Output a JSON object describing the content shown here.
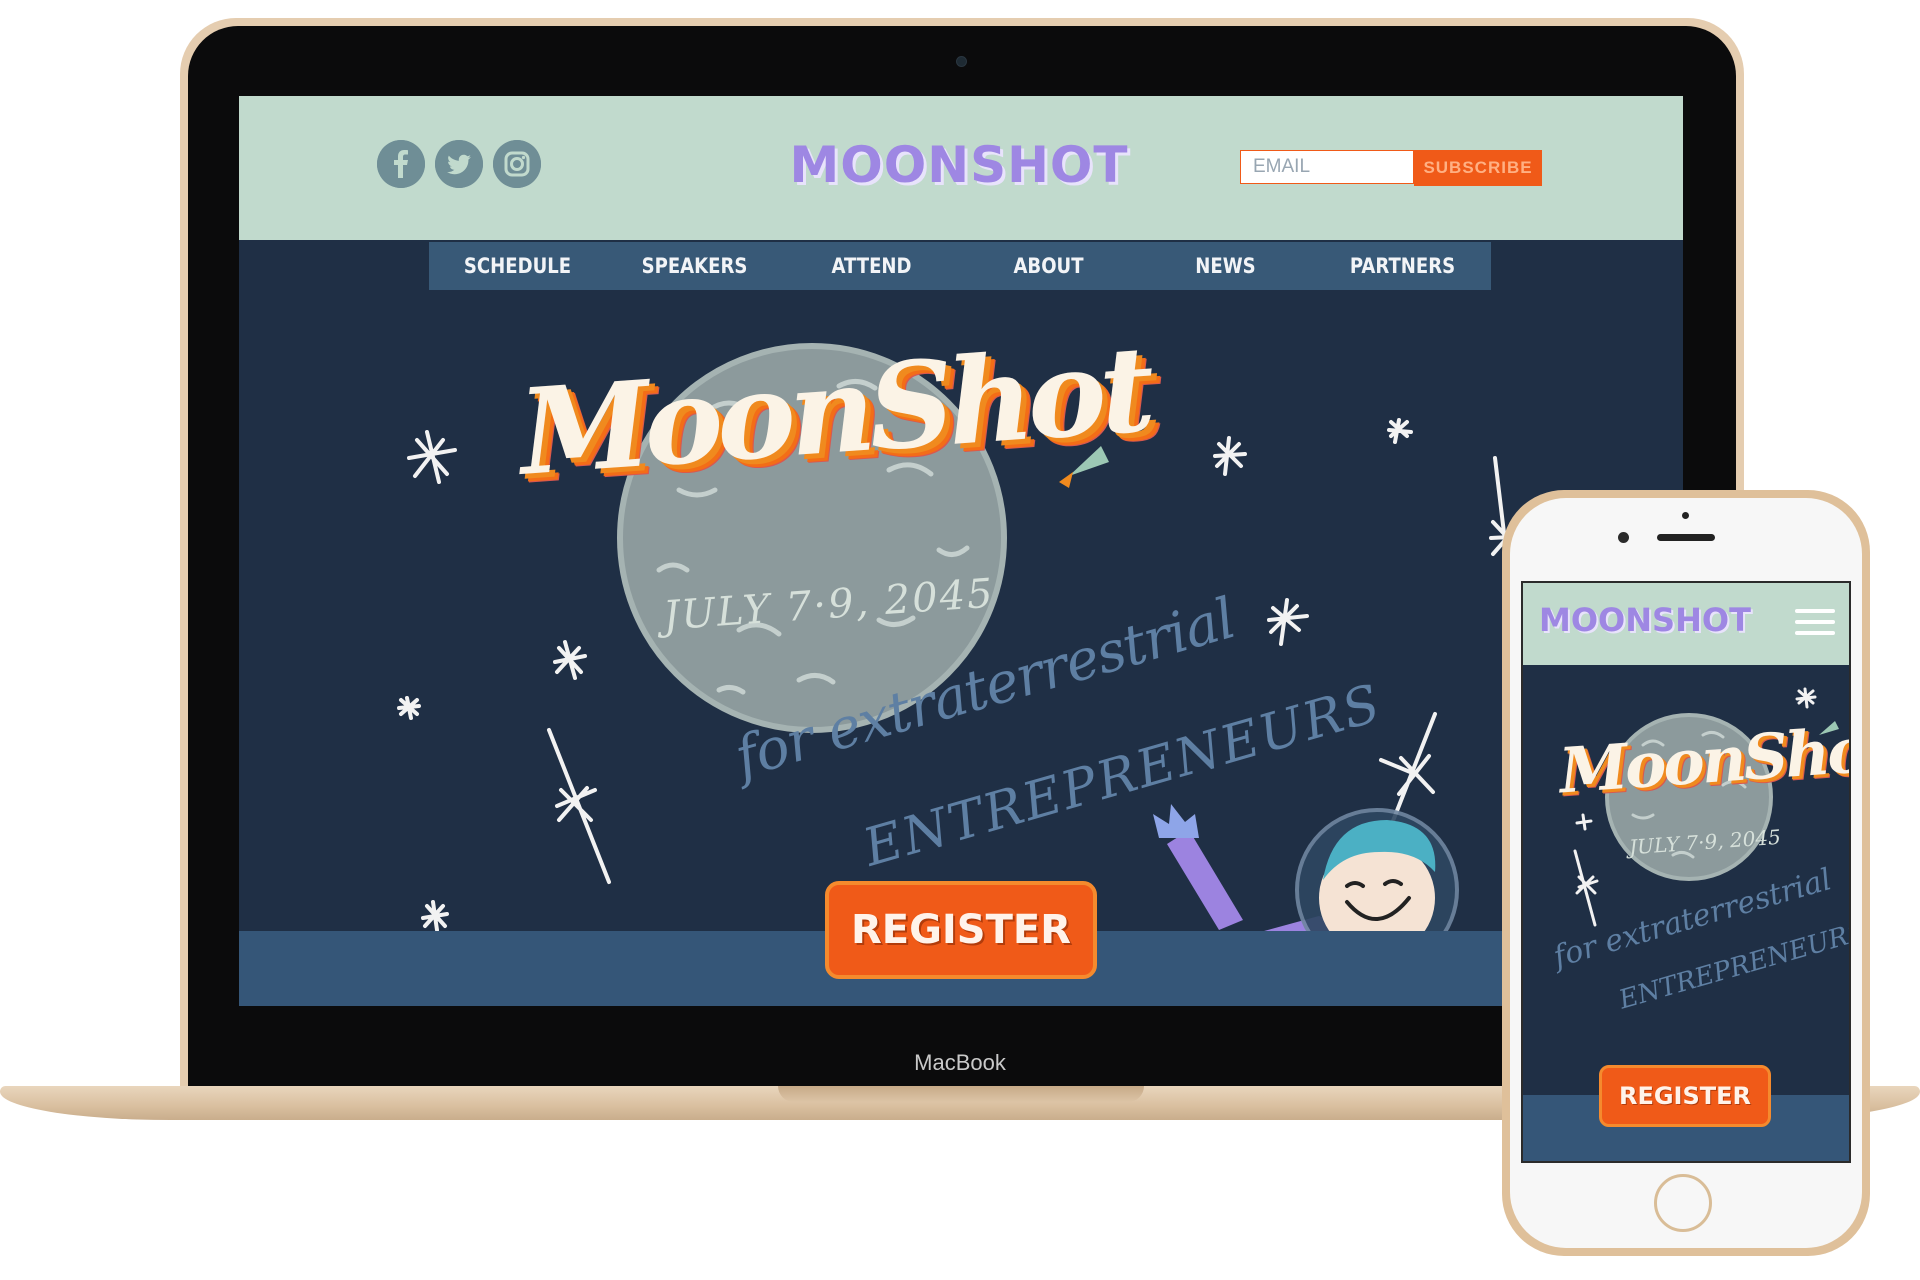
{
  "laptop": {
    "device_label": "MacBook",
    "site": {
      "social": [
        {
          "name": "facebook-icon",
          "glyph": "f"
        },
        {
          "name": "twitter-icon",
          "glyph": "🐦"
        },
        {
          "name": "instagram-icon",
          "glyph": "◎"
        }
      ],
      "logo": "MOONSHOT",
      "newsletter": {
        "placeholder": "EMAIL",
        "button": "SUBSCRIBE"
      },
      "nav": [
        "SCHEDULE",
        "SPEAKERS",
        "ATTEND",
        "ABOUT",
        "NEWS",
        "PARTNERS"
      ],
      "hero": {
        "script_title": "MoonShot",
        "date": "JULY 7·9, 2045",
        "tagline_line1": "for extraterrestrial",
        "tagline_line2": "ENTREPRENEURS",
        "register": "REGISTER"
      }
    }
  },
  "phone": {
    "logo": "MOONSHOT",
    "menu_icon": "hamburger-menu-icon",
    "hero": {
      "script_title": "MoonShot",
      "date": "JULY 7·9, 2045",
      "tagline_line1": "for extraterrestrial",
      "tagline_line2": "ENTREPRENEURS",
      "register": "REGISTER"
    }
  },
  "colors": {
    "header_bg": "#c1dacd",
    "logo_purple": "#9e87e3",
    "page_navy": "#1f2f45",
    "nav_blue": "#385977",
    "accent_orange": "#f05a18",
    "gold_frame": "#e5cdb0"
  }
}
